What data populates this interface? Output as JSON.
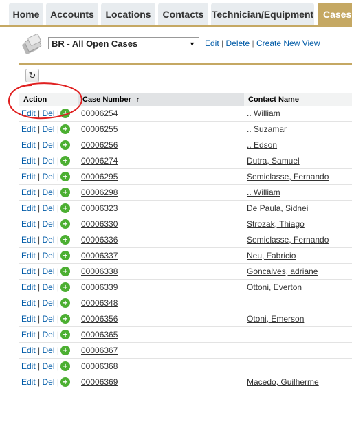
{
  "tabs": [
    {
      "label": "Home",
      "active": false
    },
    {
      "label": "Accounts",
      "active": false
    },
    {
      "label": "Locations",
      "active": false
    },
    {
      "label": "Contacts",
      "active": false
    },
    {
      "label": "Technician/Equipment",
      "active": false
    },
    {
      "label": "Cases",
      "active": true
    }
  ],
  "view": {
    "selected": "BR - All Open Cases",
    "edit_label": "Edit",
    "delete_label": "Delete",
    "create_label": "Create New View",
    "separator": "|"
  },
  "table": {
    "columns": {
      "action": "Action",
      "case_number": "Case Number",
      "sort_indicator": "↑",
      "contact_name": "Contact Name"
    },
    "action_labels": {
      "edit": "Edit",
      "del": "Del",
      "sep": "|",
      "add": "+"
    },
    "rows": [
      {
        "case": "00006254",
        "contact": ".. William"
      },
      {
        "case": "00006255",
        "contact": ".. Suzamar"
      },
      {
        "case": "00006256",
        "contact": ".. Edson"
      },
      {
        "case": "00006274",
        "contact": "Dutra, Samuel"
      },
      {
        "case": "00006295",
        "contact": "Semiclasse, Fernando"
      },
      {
        "case": "00006298",
        "contact": ".. William"
      },
      {
        "case": "00006323",
        "contact": "De Paula, Sidnei"
      },
      {
        "case": "00006330",
        "contact": "Strozak, Thiago"
      },
      {
        "case": "00006336",
        "contact": "Semiclasse, Fernando"
      },
      {
        "case": "00006337",
        "contact": "Neu, Fabricio"
      },
      {
        "case": "00006338",
        "contact": "Goncalves, adriane"
      },
      {
        "case": "00006339",
        "contact": "Ottoni, Everton"
      },
      {
        "case": "00006348",
        "contact": ""
      },
      {
        "case": "00006356",
        "contact": "Otoni, Emerson"
      },
      {
        "case": "00006365",
        "contact": ""
      },
      {
        "case": "00006367",
        "contact": ""
      },
      {
        "case": "00006368",
        "contact": ""
      },
      {
        "case": "00006369",
        "contact": "Macedo, Guilherme"
      }
    ]
  },
  "colors": {
    "accent": "#c5a863",
    "link": "#015ba7",
    "plus": "#4caf32",
    "annotation": "#e02020"
  }
}
